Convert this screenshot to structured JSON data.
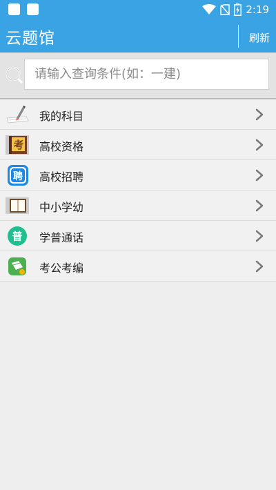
{
  "status_bar": {
    "time": "2:19"
  },
  "app_bar": {
    "title": "云题馆",
    "refresh_label": "刷新"
  },
  "search": {
    "placeholder": "请输入查询条件(如：一建)",
    "value": ""
  },
  "categories": [
    {
      "label": "我的科目",
      "icon": "pencil-paper-icon"
    },
    {
      "label": "高校资格",
      "icon": "exam-book-icon"
    },
    {
      "label": "高校招聘",
      "icon": "recruit-badge-icon"
    },
    {
      "label": "中小学幼",
      "icon": "open-book-icon"
    },
    {
      "label": "学普通话",
      "icon": "mandarin-badge-icon"
    },
    {
      "label": "考公考编",
      "icon": "civil-exam-icon"
    }
  ],
  "icon_text": {
    "exam": "考",
    "recruit": "聘",
    "mandarin": "普"
  },
  "colors": {
    "primary": "#3aa3e3",
    "background": "#eeeeee",
    "recruit": "#1e88e5",
    "mandarin": "#1fbf8f",
    "civil": "#4caf50"
  }
}
